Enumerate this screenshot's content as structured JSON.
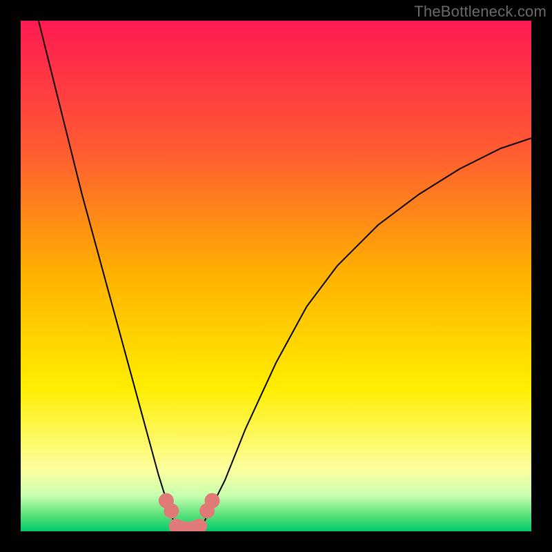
{
  "watermark": "TheBottleneck.com",
  "chart_data": {
    "type": "line",
    "title": "",
    "xlabel": "",
    "ylabel": "",
    "xlim": [
      0,
      1
    ],
    "ylim": [
      0,
      1
    ],
    "background_gradient": [
      {
        "stop": 0.0,
        "color": "#ff1a53"
      },
      {
        "stop": 0.25,
        "color": "#ff5a32"
      },
      {
        "stop": 0.5,
        "color": "#ffb200"
      },
      {
        "stop": 0.72,
        "color": "#ffee00"
      },
      {
        "stop": 0.88,
        "color": "#fcffa0"
      },
      {
        "stop": 0.93,
        "color": "#c8ffb0"
      },
      {
        "stop": 0.97,
        "color": "#55e07a"
      },
      {
        "stop": 1.0,
        "color": "#00c86a"
      }
    ],
    "series": [
      {
        "name": "bottleneck-curve",
        "color": "#000000",
        "width": 2,
        "x": [
          0.035,
          0.06,
          0.09,
          0.12,
          0.15,
          0.18,
          0.21,
          0.24,
          0.27,
          0.295,
          0.31,
          0.325,
          0.34,
          0.36,
          0.4,
          0.44,
          0.5,
          0.56,
          0.62,
          0.7,
          0.78,
          0.86,
          0.94,
          1.0
        ],
        "y": [
          1.0,
          0.9,
          0.78,
          0.66,
          0.55,
          0.44,
          0.33,
          0.22,
          0.11,
          0.03,
          0.0,
          0.0,
          0.0,
          0.02,
          0.1,
          0.2,
          0.33,
          0.44,
          0.52,
          0.6,
          0.66,
          0.71,
          0.75,
          0.77
        ]
      },
      {
        "name": "bottom-markers",
        "color": "#e07a78",
        "marker_radius": 11,
        "x": [
          0.285,
          0.295,
          0.305,
          0.32,
          0.335,
          0.35,
          0.365,
          0.375
        ],
        "y": [
          0.06,
          0.04,
          0.01,
          0.005,
          0.005,
          0.01,
          0.04,
          0.06
        ]
      }
    ]
  }
}
